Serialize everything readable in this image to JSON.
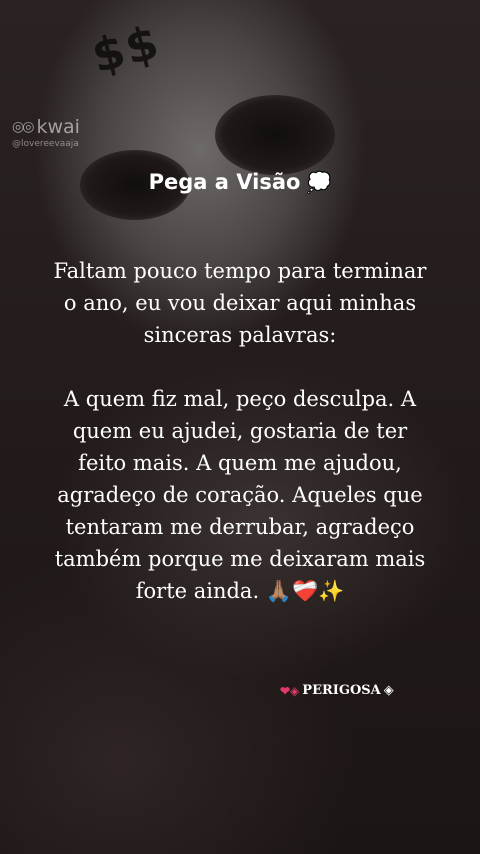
{
  "watermark": {
    "brand": "kwai",
    "icon": "kwai-logo-icon",
    "handle": "@lovereevaaja"
  },
  "title": {
    "text": "Pega a Visão",
    "emoji": "💭"
  },
  "paragraphs": [
    "Faltam pouco tempo para terminar o ano, eu vou deixar aqui minhas sinceras palavras:",
    "A quem fiz mal, peço desculpa. A quem eu ajudei, gostaria de ter feito mais. A quem me ajudou, agradeço de coração. Aqueles que tentaram me derrubar, agradeço também porque me deixaram mais forte ainda. 🙏🏽❤️‍🩹✨"
  ],
  "signature": {
    "text": "PERIGOSA",
    "left_icon": "heart-diamond-icon",
    "right_icon": "diamond-icon"
  },
  "mask_mark": "$$"
}
